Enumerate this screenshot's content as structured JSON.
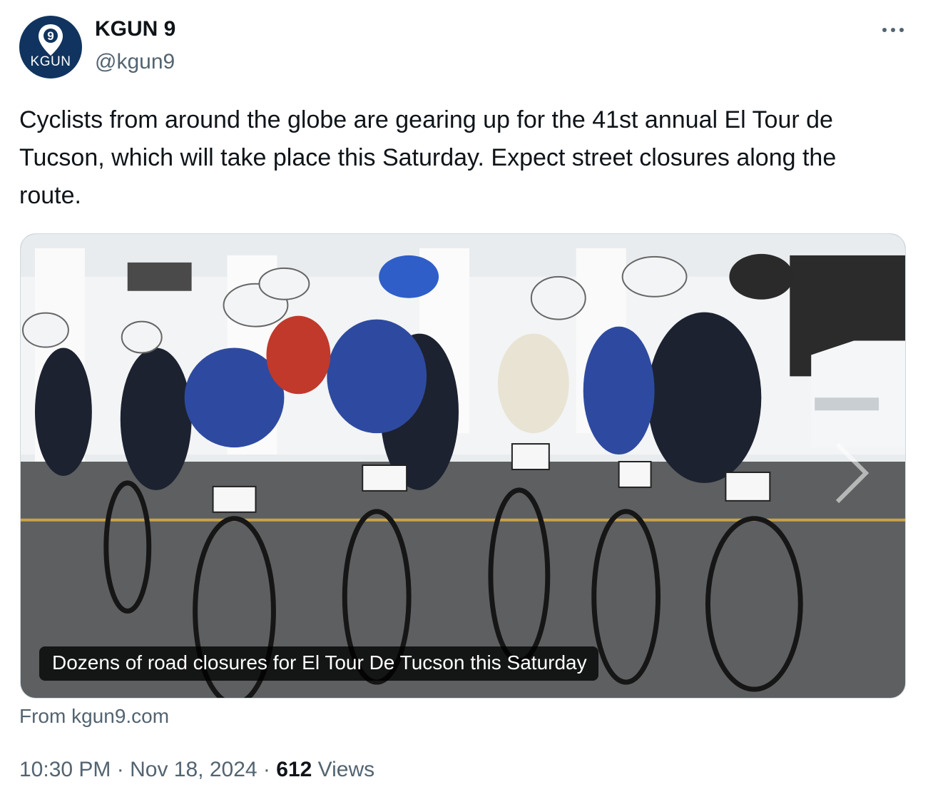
{
  "author": {
    "display_name": "KGUN 9",
    "handle": "@kgun9",
    "avatar_logo_text": "KGUN",
    "avatar_color": "#10345f"
  },
  "tweet": {
    "text": "Cyclists from around the globe are gearing up for the 41st annual El Tour de Tucson, which will take place this Saturday. Expect street closures along the route."
  },
  "card": {
    "caption": "Dozens of road closures for El Tour De Tucson this Saturday",
    "source": "From kgun9.com"
  },
  "meta": {
    "time": "10:30 PM",
    "sep1": "·",
    "date": "Nov 18, 2024",
    "sep2": "·",
    "views_count": "612",
    "views_label": "Views"
  },
  "icons": {
    "more": "more-options-icon",
    "avatar_pin": "location-pin-9-icon"
  }
}
